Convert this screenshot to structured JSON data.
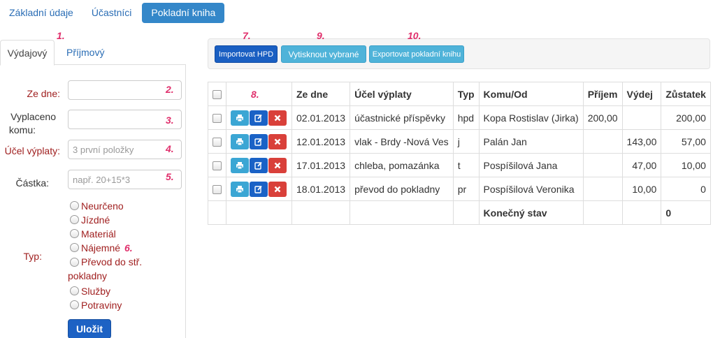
{
  "nav": [
    {
      "label": "Základní údaje",
      "active": false
    },
    {
      "label": "Účastníci",
      "active": false
    },
    {
      "label": "Pokladní kniha",
      "active": true
    }
  ],
  "tabs": {
    "expense": "Výdajový",
    "income": "Příjmový"
  },
  "form": {
    "date_label": "Ze dne:",
    "paid_to_label_1": "Vyplaceno",
    "paid_to_label_2": "komu:",
    "purpose_label": "Účel výplaty:",
    "purpose_placeholder": "3 první položky",
    "amount_label": "Částka:",
    "amount_placeholder": "např. 20+15*3",
    "type_label": "Typ:",
    "types": [
      "Neurčeno",
      "Jízdné",
      "Materiál",
      "Nájemné",
      "Převod do stř. pokladny",
      "Služby",
      "Potraviny"
    ],
    "save_label": "Uložit"
  },
  "toolbar": {
    "import_label": "Importovat HPD",
    "print_label": "Vytisknout vybrané",
    "export_label": "Exportovat pokladní knihu"
  },
  "markers": [
    "1.",
    "2.",
    "3.",
    "4.",
    "5.",
    "6.",
    "7.",
    "8.",
    "9.",
    "10."
  ],
  "table": {
    "headers": {
      "date": "Ze dne",
      "purpose": "Účel výplaty",
      "type": "Typ",
      "person": "Komu/Od",
      "income": "Příjem",
      "expense": "Výdej",
      "balance": "Zůstatek"
    },
    "rows": [
      {
        "date": "02.01.2013",
        "purpose": "účastnické příspěvky",
        "type": "hpd",
        "person": "Kopa Rostislav (Jirka)",
        "income": "200,00",
        "expense": "",
        "balance": "200,00"
      },
      {
        "date": "12.01.2013",
        "purpose": "vlak - Brdy -Nová Ves",
        "type": "j",
        "person": "Palán Jan",
        "income": "",
        "expense": "143,00",
        "balance": "57,00"
      },
      {
        "date": "17.01.2013",
        "purpose": "chleba, pomazánka",
        "type": "t",
        "person": "Pospíšilová Jana",
        "income": "",
        "expense": "47,00",
        "balance": "10,00"
      },
      {
        "date": "18.01.2013",
        "purpose": "převod do pokladny",
        "type": "pr",
        "person": "Pospíšilová Veronika",
        "income": "",
        "expense": "10,00",
        "balance": "0"
      }
    ],
    "footer": {
      "label": "Konečný stav",
      "balance": "0"
    }
  },
  "colors": {
    "accent": "#3487c9",
    "link": "#2a6db5",
    "label_red": "#a02020",
    "marker": "#e0306c",
    "delete": "#d9403a"
  }
}
